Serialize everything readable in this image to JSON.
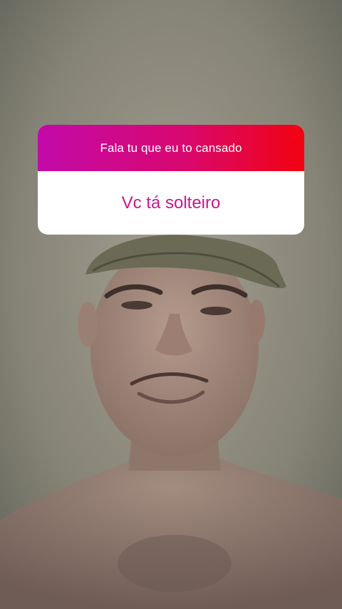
{
  "story": {
    "question_sticker": {
      "prompt": "Fala tu que eu to cansado",
      "answer": "Vc tá solteiro",
      "header_gradient": [
        "#c20aa9",
        "#d9086f",
        "#f2020f"
      ],
      "answer_color": "#c7188c"
    },
    "background_photo": {
      "icon": "selfie-photo"
    }
  }
}
